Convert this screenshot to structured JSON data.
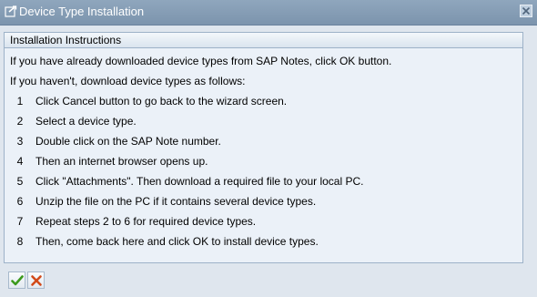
{
  "window": {
    "title": "Device Type Installation"
  },
  "group": {
    "title": "Installation Instructions",
    "intro1": "If you have already downloaded device types from SAP Notes, click OK button.",
    "intro2": "If you haven't, download device types as follows:"
  },
  "steps": [
    {
      "num": "1",
      "text": "Click Cancel button to go back to the wizard screen."
    },
    {
      "num": "2",
      "text": "Select a device type."
    },
    {
      "num": "3",
      "text": "Double click on the SAP Note number."
    },
    {
      "num": "4",
      "text": "Then an internet browser opens up."
    },
    {
      "num": "5",
      "text": "Click \"Attachments\". Then download a required file to your local PC."
    },
    {
      "num": "6",
      "text": "Unzip the file on the PC if it contains several device types."
    },
    {
      "num": "7",
      "text": "Repeat steps 2 to 6 for required device types."
    },
    {
      "num": "8",
      "text": "Then, come back here and click OK to install device types."
    }
  ],
  "footer": {
    "ok_icon": "checkmark-icon",
    "cancel_icon": "cross-icon"
  },
  "colors": {
    "titlebar": "#8fa6bd",
    "background": "#dfe6ee",
    "group_background": "#ebf1f8",
    "ok_green": "#3c9a1e",
    "cancel_red": "#d24a1a"
  }
}
